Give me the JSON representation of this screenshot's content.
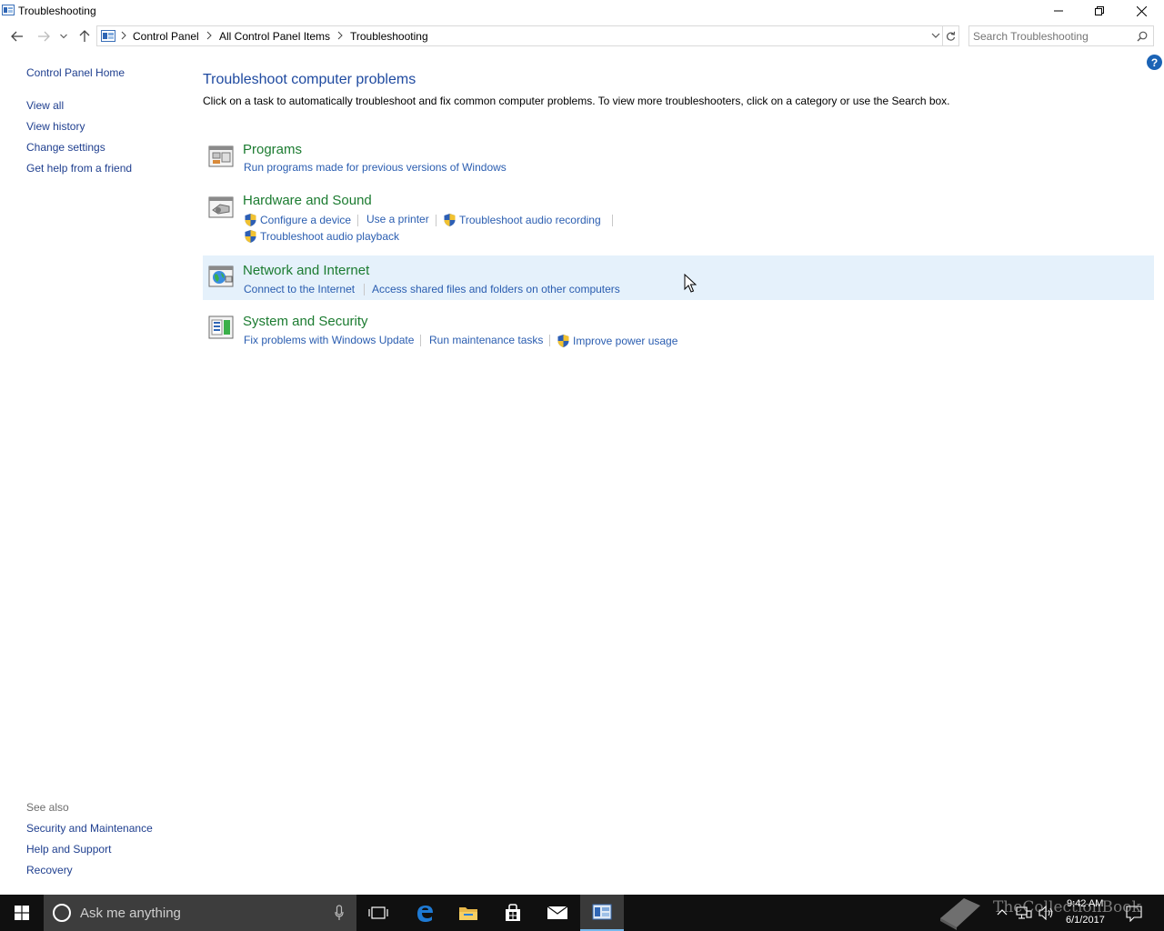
{
  "window": {
    "title": "Troubleshooting"
  },
  "address": {
    "crumbs": [
      "Control Panel",
      "All Control Panel Items",
      "Troubleshooting"
    ]
  },
  "search": {
    "placeholder": "Search Troubleshooting"
  },
  "sidebar": {
    "home": "Control Panel Home",
    "links": [
      "View all",
      "View history",
      "Change settings",
      "Get help from a friend"
    ],
    "see_also_title": "See also",
    "see_also": [
      "Security and Maintenance",
      "Help and Support",
      "Recovery"
    ]
  },
  "main": {
    "heading": "Troubleshoot computer problems",
    "intro": "Click on a task to automatically troubleshoot and fix common computer problems. To view more troubleshooters, click on a category or use the Search box.",
    "categories": [
      {
        "title": "Programs",
        "icon": "programs-icon",
        "tasks": [
          "Run programs made for previous versions of Windows"
        ]
      },
      {
        "title": "Hardware and Sound",
        "icon": "hardware-sound-icon",
        "tasks": [
          "Configure a device",
          "Use a printer",
          "Troubleshoot audio recording",
          "Troubleshoot audio playback"
        ]
      },
      {
        "title": "Network and Internet",
        "icon": "network-icon",
        "tasks": [
          "Connect to the Internet",
          "Access shared files and folders on other computers"
        ]
      },
      {
        "title": "System and Security",
        "icon": "system-security-icon",
        "tasks": [
          "Fix problems with Windows Update",
          "Run maintenance tasks",
          "Improve power usage"
        ]
      }
    ]
  },
  "taskbar": {
    "search_placeholder": "Ask me anything",
    "time": "9:42 AM",
    "date": "6/1/2017",
    "watermark": "TheCollectionBook"
  },
  "colors": {
    "link": "#2a5db0",
    "category_title": "#1b7b30",
    "heading": "#1f4aa0",
    "hover_row": "#e5f1fb",
    "taskbar": "#101010"
  }
}
